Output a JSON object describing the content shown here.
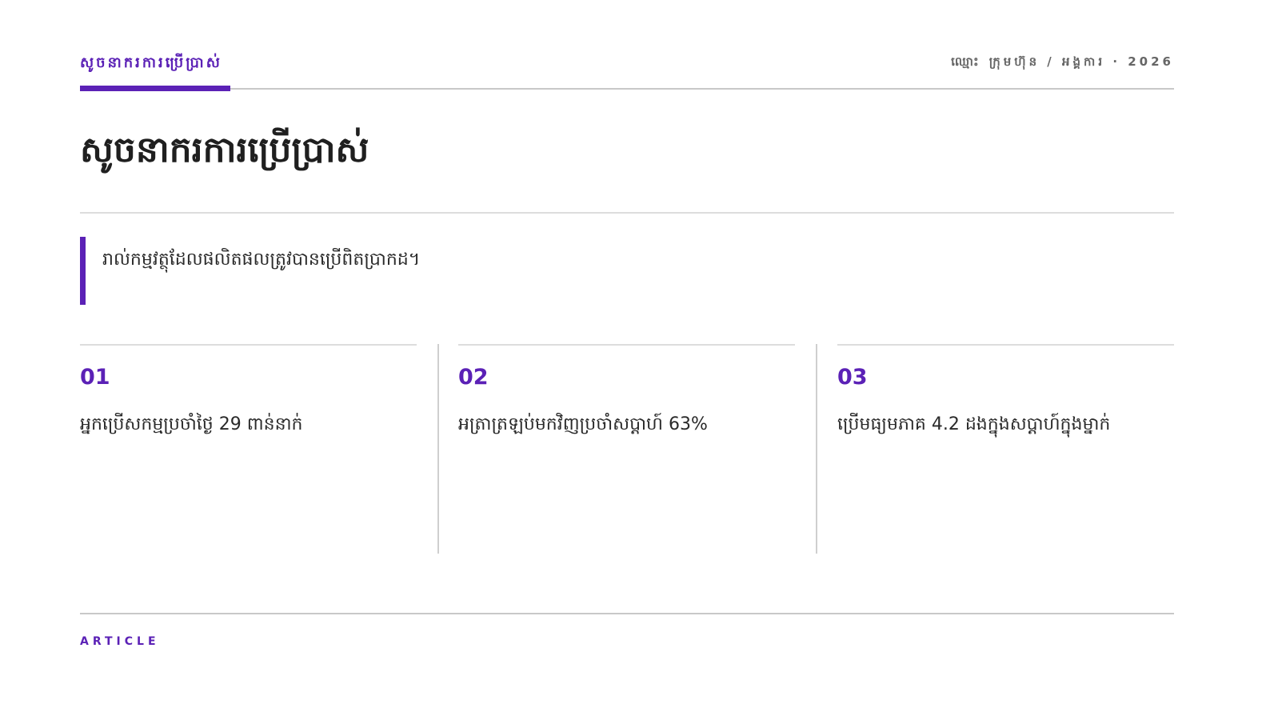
{
  "header": {
    "kicker": "សូចនាករការប្រើប្រាស់",
    "meta": "ឈ្មោះ ក្រុមហ៊ុន / អង្គការ · 2026"
  },
  "page": {
    "title": "សូចនាករការប្រើប្រាស់",
    "lead": "រាល់កម្មវត្ថុដែលផលិតផលត្រូវបានប្រើពិតប្រាកដ។"
  },
  "metrics": [
    {
      "number": "01",
      "text": "អ្នកប្រើសកម្មប្រចាំថ្ងៃ 29 ពាន់នាក់"
    },
    {
      "number": "02",
      "text": "អត្រាត្រឡប់មកវិញប្រចាំសប្តាហ៍ 63%"
    },
    {
      "number": "03",
      "text": "ប្រើមធ្យមភាគ 4.2 ដងក្នុងសប្តាហ៍ក្នុងម្នាក់"
    }
  ],
  "footer": {
    "label": "ARTICLE"
  },
  "colors": {
    "accent": "#5b21b6",
    "rule": "#c8c8c8",
    "text": "#222222"
  }
}
